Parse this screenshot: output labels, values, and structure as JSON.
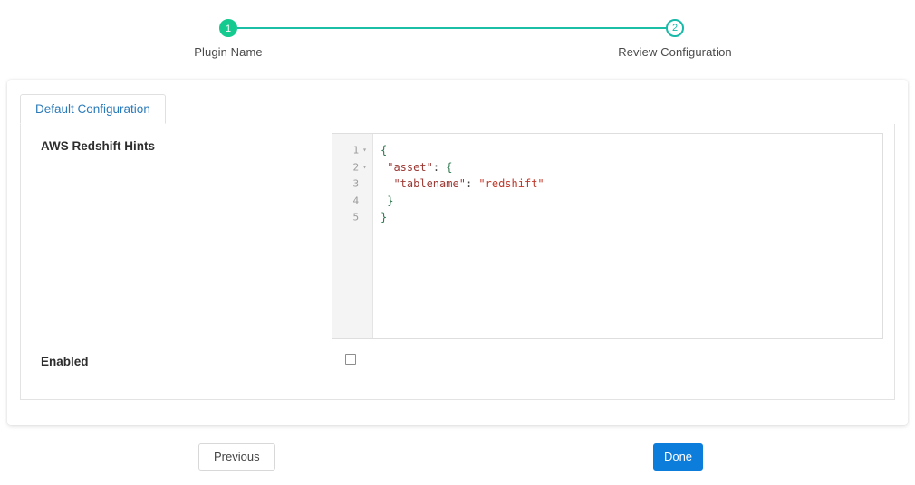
{
  "stepper": {
    "connector_color": "#1bbfa5",
    "steps": [
      {
        "number": "1",
        "label": "Plugin Name",
        "state": "done",
        "color": "#14ca8f"
      },
      {
        "number": "2",
        "label": "Review Configuration",
        "state": "current",
        "color": "#17b9a8"
      }
    ]
  },
  "tabs": [
    {
      "label": "Default Configuration",
      "active": true,
      "color": "#2a7ab9"
    }
  ],
  "form": {
    "hints_label": "AWS Redshift Hints",
    "enabled_label": "Enabled",
    "enabled_checked": false
  },
  "editor": {
    "lines": [
      {
        "number": "1",
        "foldable": true,
        "text": "{"
      },
      {
        "number": "2",
        "foldable": true,
        "text": " \"asset\": {"
      },
      {
        "number": "3",
        "foldable": false,
        "text": "  \"tablename\": \"redshift\""
      },
      {
        "number": "4",
        "foldable": false,
        "text": " }"
      },
      {
        "number": "5",
        "foldable": false,
        "text": "}"
      }
    ],
    "fold_glyph": "▾",
    "tokens": {
      "line1": {
        "brace": "{"
      },
      "line2": {
        "key": "\"asset\"",
        "punct": ": ",
        "brace": "{"
      },
      "line3": {
        "key": "\"tablename\"",
        "punct": ": ",
        "str": "\"redshift\""
      },
      "line4": {
        "brace": "}"
      },
      "line5": {
        "brace": "}"
      }
    },
    "colors": {
      "brace": "#2f7a4f",
      "key": "#9c3a35",
      "string": "#c0392b",
      "gutter_bg": "#f4f4f4",
      "line_number": "#9b9b9b"
    }
  },
  "footer": {
    "previous_label": "Previous",
    "done_label": "Done",
    "done_color": "#0d7ddb"
  }
}
